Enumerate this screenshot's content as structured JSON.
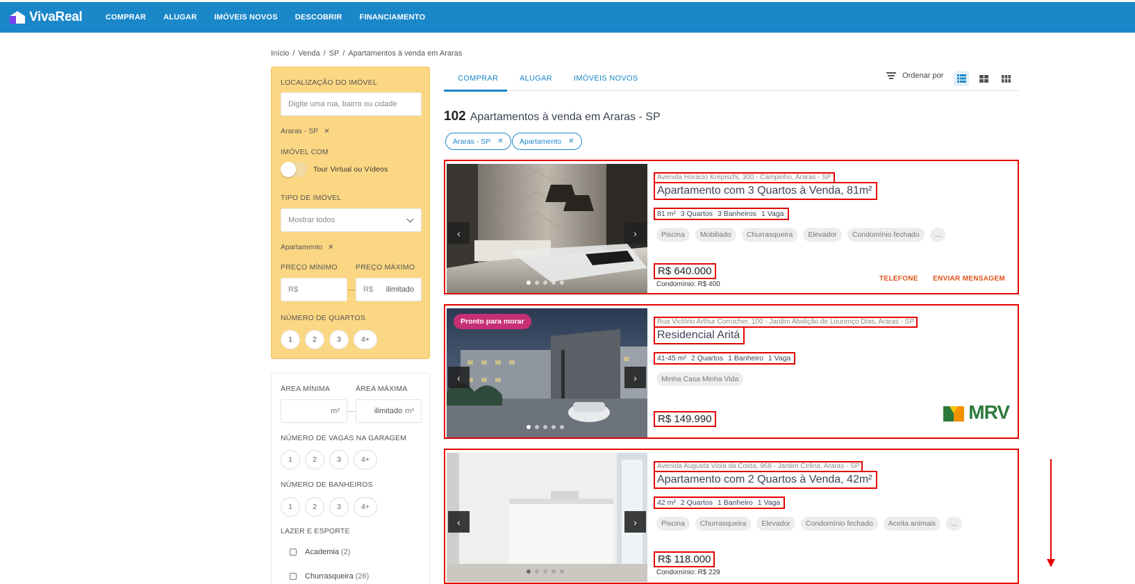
{
  "brand": {
    "name": "VivaReal"
  },
  "nav": [
    "COMPRAR",
    "ALUGAR",
    "IMÓVEIS NOVOS",
    "DESCOBRIR",
    "FINANCIAMENTO"
  ],
  "breadcrumb": [
    "Início",
    "Venda",
    "SP",
    "Apartamentos à venda em Araras"
  ],
  "filters": {
    "location_label": "LOCALIZAÇÃO DO IMÓVEL",
    "location_placeholder": "Digite uma rua, bairro ou cidade",
    "location_chip": "Araras - SP",
    "with_label": "IMÓVEL COM",
    "tour_label": "Tour Virtual ou Vídeos",
    "type_label": "TIPO DE IMÓVEL",
    "type_value": "Mostrar todos",
    "type_chip": "Apartamento",
    "min_price_label": "PREÇO MÍNIMO",
    "max_price_label": "PREÇO MÁXIMO",
    "currency": "R$",
    "max_price_value": "ilimitado",
    "bedrooms_label": "NÚMERO DE QUARTOS",
    "counts": [
      "1",
      "2",
      "3",
      "4+"
    ],
    "min_area_label": "ÁREA MÍNIMA",
    "max_area_label": "ÁREA MÁXIMA",
    "area_unit": "m²",
    "max_area_value": "ilimitado",
    "garage_label": "NÚMERO DE VAGAS NA GARAGEM",
    "bathrooms_label": "NÚMERO DE BANHEIROS",
    "leisure_label": "LAZER E ESPORTE",
    "leisure": [
      {
        "label": "Academia",
        "count": "(2)"
      },
      {
        "label": "Churrasqueira",
        "count": "(26)"
      }
    ]
  },
  "tabs": [
    "COMPRAR",
    "ALUGAR",
    "IMÓVEIS NOVOS"
  ],
  "sort_label": "Ordenar por",
  "results": {
    "count": "102",
    "title": "Apartamentos à venda em Araras - SP",
    "pills": [
      "Araras - SP",
      "Apartamento"
    ]
  },
  "listings": [
    {
      "address": "Avenida Horácio Krepischi, 300 - Campinho, Araras - SP",
      "title": "Apartamento com 3 Quartos à Venda, 81m²",
      "features": [
        "81 m²",
        "3 Quartos",
        "3 Banheiros",
        "1 Vaga"
      ],
      "amenities": [
        "Piscina",
        "Mobiliado",
        "Churrasqueira",
        "Elevador",
        "Condomínio fechado",
        "..."
      ],
      "price": "R$ 640.000",
      "condo": "Condomínio: R$ 400",
      "cta_phone": "TELEFONE",
      "cta_message": "ENVIAR MENSAGEM"
    },
    {
      "badge": "Pronto para morar",
      "address": "Rua Victório Arthur Corrocher, 100 - Jardim Abolição de Lourenço Dias, Araras - SP",
      "title": "Residencial Aritá",
      "features": [
        "41-45 m²",
        "2 Quartos",
        "1 Banheiro",
        "1 Vaga"
      ],
      "amenities": [
        "Minha Casa Minha Vida"
      ],
      "price": "R$ 149.990",
      "logo": "MRV"
    },
    {
      "address": "Avenida Augusta Viola da Costa, 968 - Jardim Celina, Araras - SP",
      "title": "Apartamento com 2 Quartos à Venda, 42m²",
      "features": [
        "42 m²",
        "2 Quartos",
        "1 Banheiro",
        "1 Vaga"
      ],
      "amenities": [
        "Piscina",
        "Churrasqueira",
        "Elevador",
        "Condomínio fechado",
        "Aceita animais",
        "..."
      ],
      "price": "R$ 118.000",
      "condo": "Condomínio: R$ 229"
    }
  ],
  "colors": {
    "header": "#1a87c9",
    "filter_panel": "#fbd783",
    "highlight": "#e50000",
    "cta": "#e0541b"
  }
}
